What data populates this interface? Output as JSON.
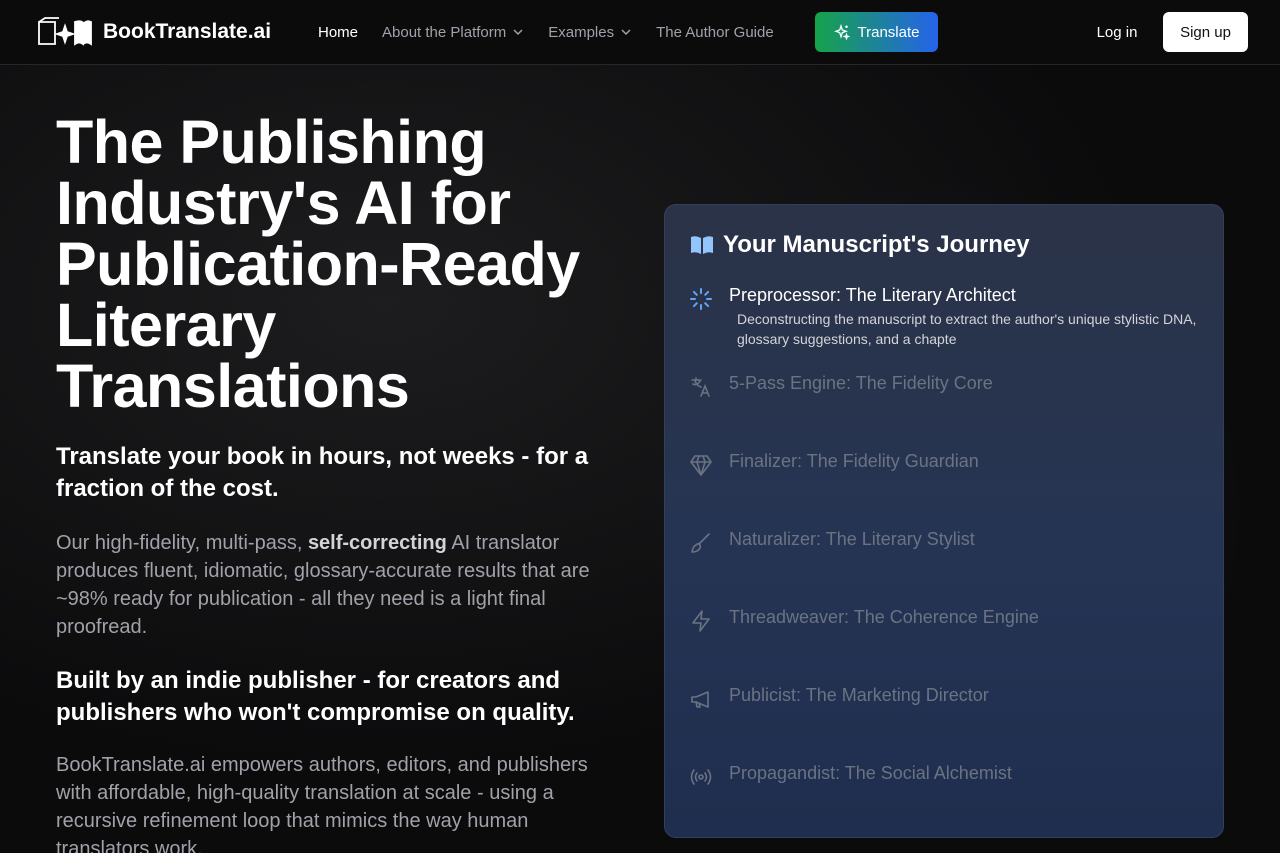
{
  "brand": {
    "name": "BookTranslate.ai"
  },
  "nav": {
    "home": "Home",
    "about": "About the Platform",
    "examples": "Examples",
    "author_guide": "The Author Guide",
    "translate": "Translate",
    "login": "Log in",
    "signup": "Sign up"
  },
  "hero": {
    "title": "The Publishing Industry's AI for Publication-Ready Literary Translations",
    "subtitle": "Translate your book in hours, not weeks - for a fraction of the cost.",
    "p1_a": "Our high-fidelity, multi-pass, ",
    "p1_bold": "self-correcting",
    "p1_b": " AI translator produces fluent, idiomatic, glossary-accurate results that are ~98% ready for publication - all they need is a light final proofread.",
    "subtitle2": "Built by an indie publisher - for creators and publishers who won't compromise on quality.",
    "p2": "BookTranslate.ai empowers authors, editors, and publishers with affordable, high-quality translation at scale - using a recursive refinement loop that mimics the way human translators work."
  },
  "journey": {
    "title": "Your Manuscript's Journey",
    "steps": [
      {
        "label": "Preprocessor: The Literary Architect",
        "desc": "Deconstructing the manuscript to extract the author's unique stylistic DNA, glossary suggestions, and a chapte",
        "icon": "loader-icon"
      },
      {
        "label": "5-Pass Engine: The Fidelity Core",
        "icon": "languages-icon"
      },
      {
        "label": "Finalizer: The Fidelity Guardian",
        "icon": "gem-icon"
      },
      {
        "label": "Naturalizer: The Literary Stylist",
        "icon": "brush-icon"
      },
      {
        "label": "Threadweaver: The Coherence Engine",
        "icon": "zap-icon"
      },
      {
        "label": "Publicist: The Marketing Director",
        "icon": "megaphone-icon"
      },
      {
        "label": "Propagandist: The Social Alchemist",
        "icon": "radio-icon"
      }
    ]
  },
  "colors": {
    "accent_green": "#16a34a",
    "accent_blue": "#2563eb",
    "active_icon": "#60a5fa",
    "dim_text": "#6b7383"
  }
}
